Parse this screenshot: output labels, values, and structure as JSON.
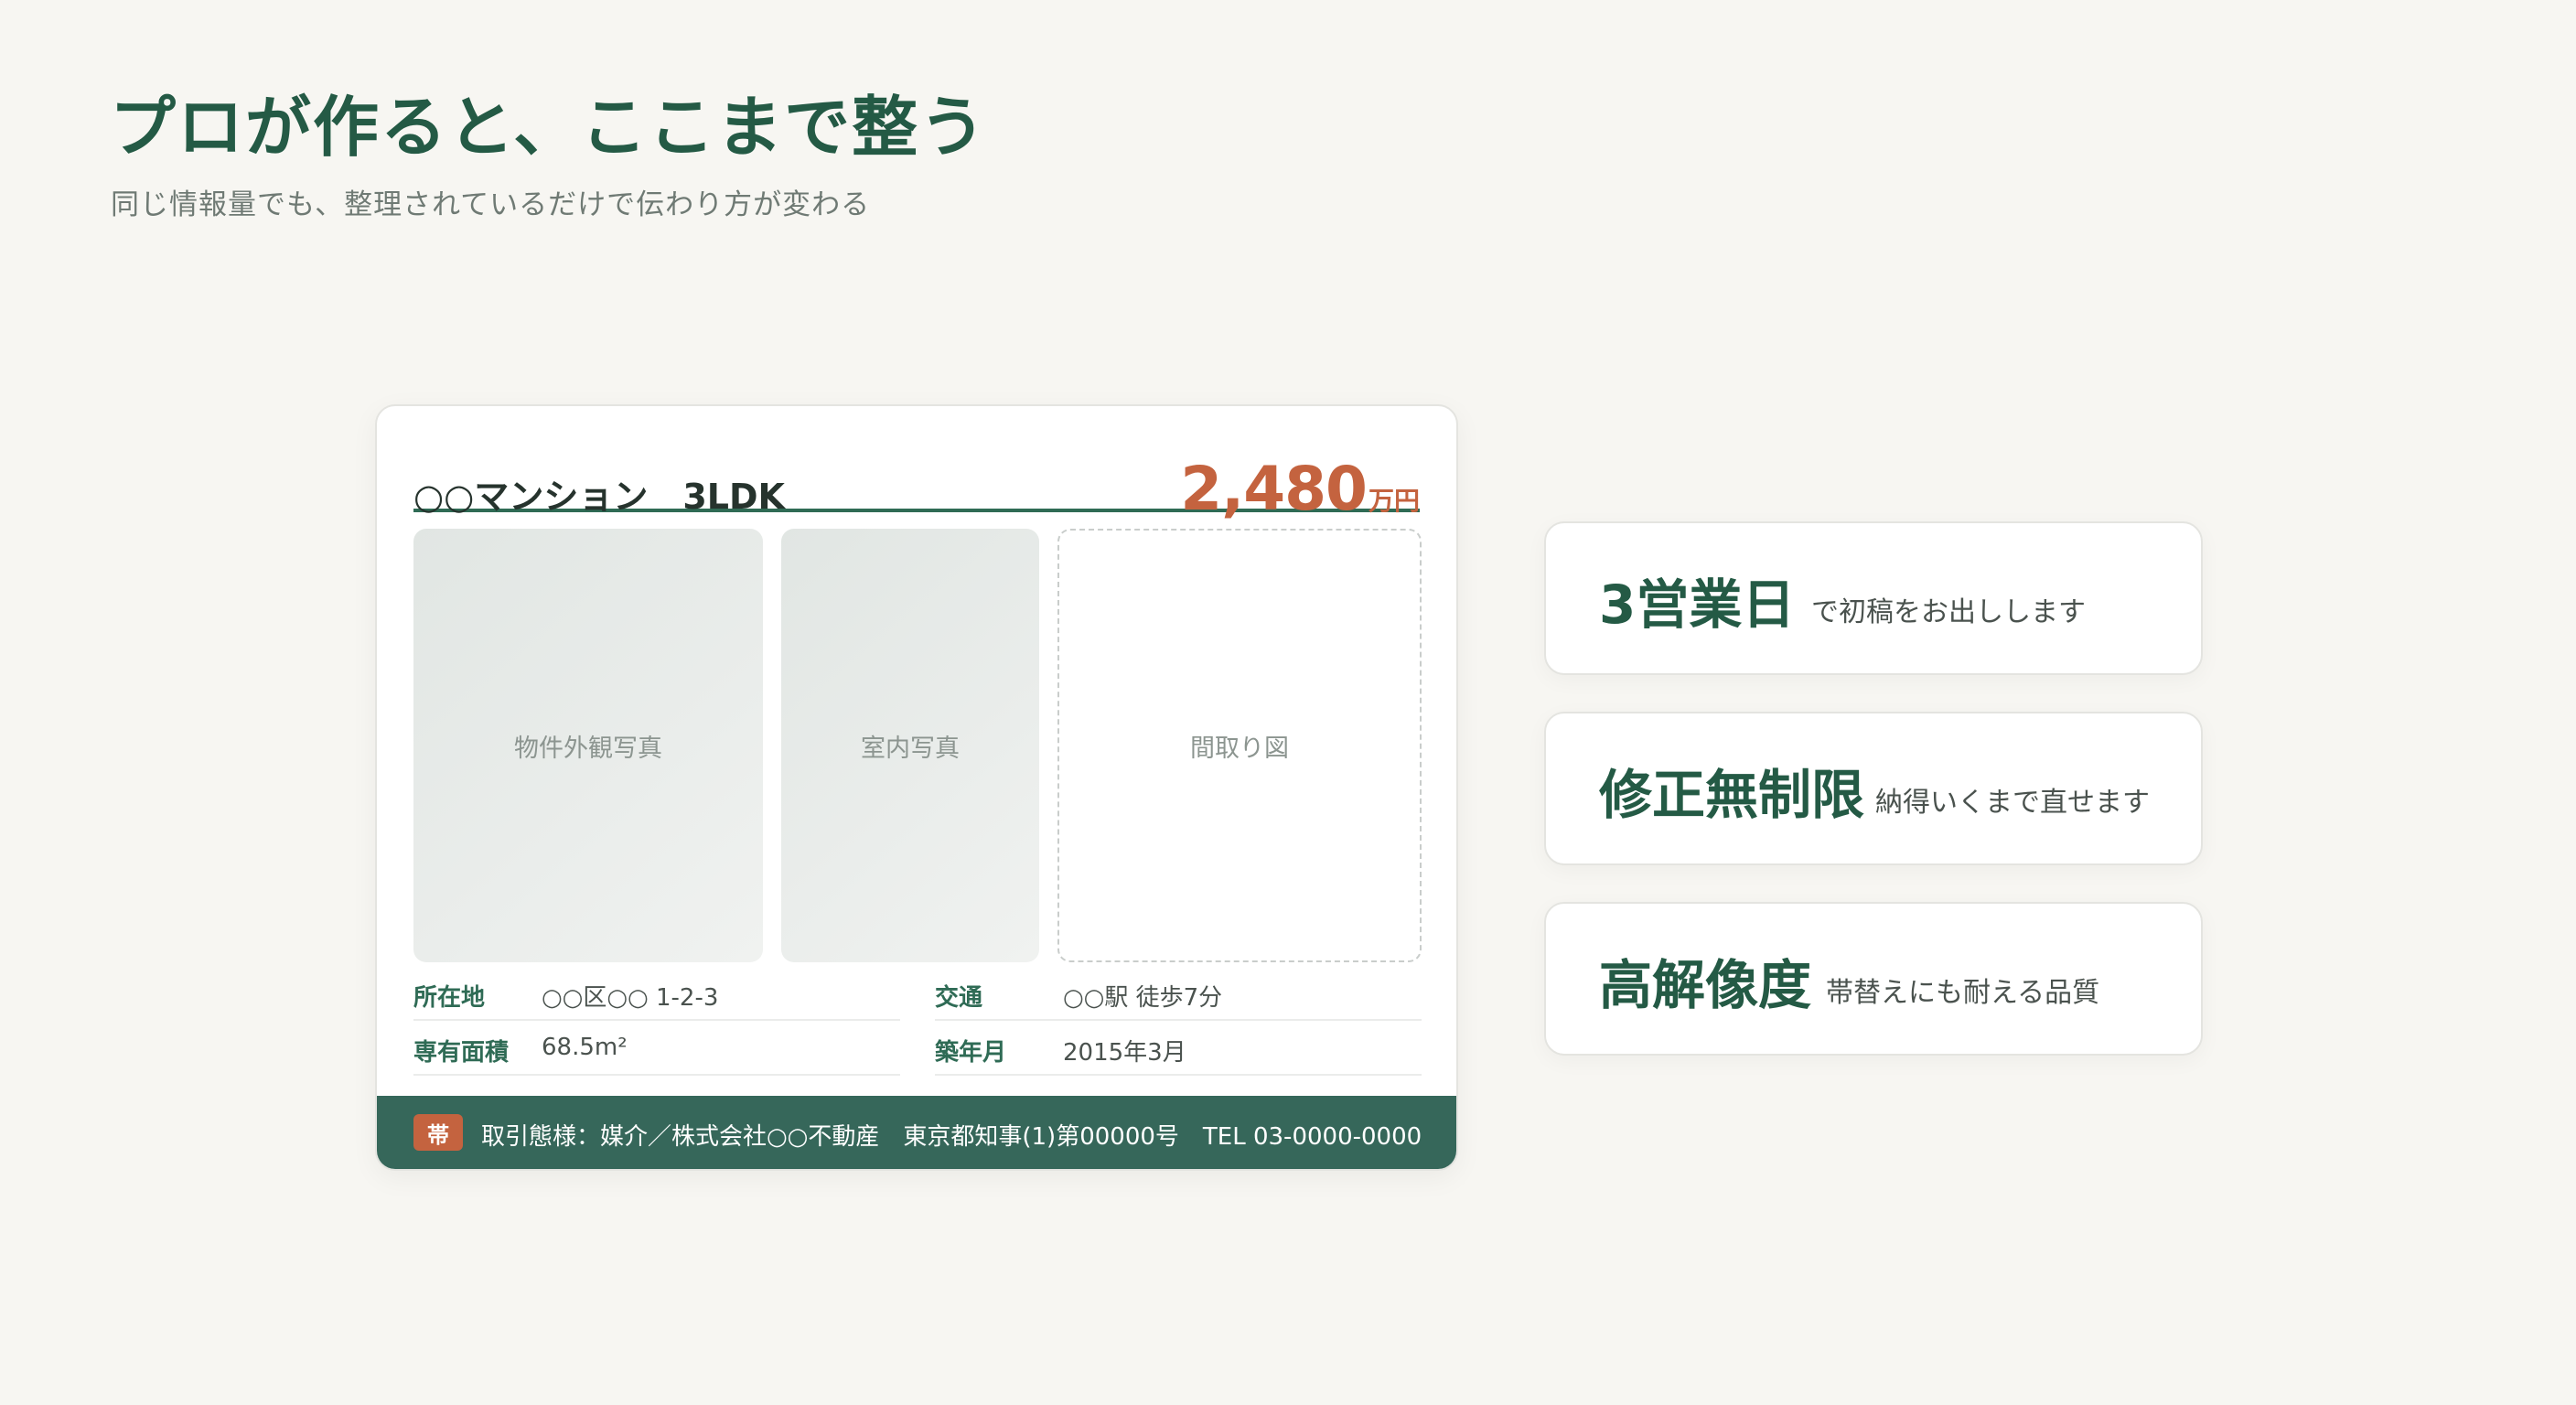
{
  "heading": "プロが作ると、ここまで整う",
  "subheading": "同じ情報量でも、整理されているだけで伝わり方が変わる",
  "listing": {
    "title": "○○マンション　3LDK",
    "price_value": "2,480",
    "price_unit": "万円",
    "photos": {
      "exterior": "物件外観写真",
      "interior": "室内写真",
      "floorplan": "間取り図"
    },
    "info": [
      {
        "label": "所在地",
        "value": "○○区○○ 1-2-3"
      },
      {
        "label": "交通",
        "value": "○○駅 徒歩7分"
      },
      {
        "label": "専有面積",
        "value": "68.5m²"
      },
      {
        "label": "築年月",
        "value": "2015年3月"
      }
    ],
    "footer": {
      "badge": "帯",
      "text": "取引態様：媒介／株式会社○○不動産　東京都知事(1)第00000号　TEL 03-0000-0000"
    }
  },
  "features": [
    {
      "title": "3営業日",
      "desc": "で初稿をお出しします"
    },
    {
      "title": "修正無制限",
      "desc": "納得いくまで直せます"
    },
    {
      "title": "高解像度",
      "desc": "帯替えにも耐える品質"
    }
  ],
  "colors": {
    "accent_green": "#245a45",
    "price_orange": "#c4633f",
    "footer_green": "#36675a",
    "background": "#f7f6f2"
  }
}
